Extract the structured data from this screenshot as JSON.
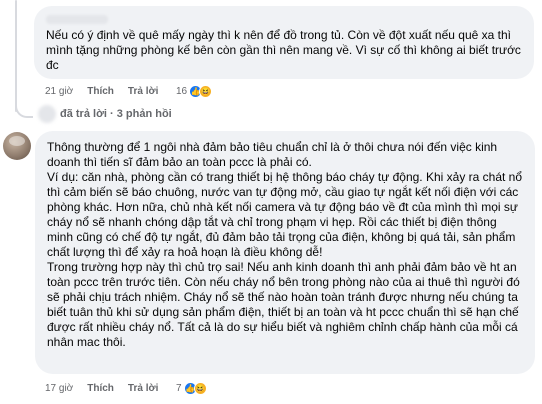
{
  "comments": [
    {
      "text": "Nếu có ý định về quê mấy ngày thì k nên để đồ trong tủ. Còn về đột xuất nếu quê xa thì mình tặng những phòng kế bên còn gần thì nên mang về. Vì sự cố thì không ai biết trước đc",
      "time": "21 giờ",
      "like_label": "Thích",
      "reply_label": "Trả lời",
      "reaction_count": "16",
      "reactions": [
        "like-icon",
        "haha-icon"
      ]
    },
    {
      "paragraphs": [
        "Thông thường để 1 ngôi nhà đảm bảo tiêu chuẩn chỉ là ở thôi chưa nói đến việc kinh doanh thì tiến sĩ đảm bảo an toàn pccc là phải có.",
        "Ví dụ: căn nhà, phòng cần có trang thiết bị hệ thông báo cháy tự động. Khi xảy ra chát nổ thì cảm biến sẽ báo chuông, nước van tự động mở, cầu giao tự ngắt kết nối điện với các phòng khác. Hơn nữa, chủ nhà kết nối camera và tự động báo về đt của mình thì mọi sự cháy nổ sẽ nhanh chóng dập tắt và chỉ trong phạm vi hẹp. Rồi các thiết bị điện thông minh cũng có chế độ tự ngắt, đủ đảm bảo tải trọng của điện, không bị quá tải, sản phẩm chất lượng thì để xảy ra hoả hoạn là điều không dễ!",
        "Trong trường hợp này thì chủ trọ sai! Nếu anh kinh doanh thì anh phải đảm bảo về ht an toàn pccc trên trước tiên. Còn nếu cháy nổ bên trong phòng nào của ai thuê thì người đó sẽ phải chịu trách nhiệm. Cháy nổ sẽ thế nào hoàn toàn tránh được nhưng nếu chúng ta biết tuân thủ khi sử dụng sản phẩm điện, thiết bị an toàn và ht pccc chuẩn thì sẽ hạn chế được rất nhiều cháy nổ. Tất cả là do sự hiểu biết và nghiêm chỉnh chấp hành của mỗi cá nhân mac thôi."
      ],
      "time": "17 giờ",
      "like_label": "Thích",
      "reply_label": "Trả lời",
      "reaction_count": "7",
      "reactions": [
        "like-icon",
        "haha-icon"
      ]
    }
  ],
  "replies_summary": "đã trả lời · 3 phản hồi",
  "colors": {
    "bubble": "#f0f2f5",
    "muted_text": "#65676b",
    "like_blue": "#1877f2",
    "haha_yellow": "#f7b125"
  }
}
